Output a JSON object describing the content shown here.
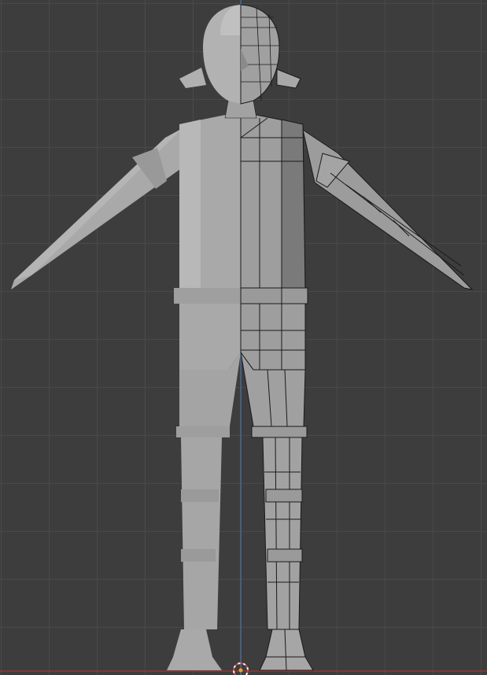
{
  "viewport": {
    "background_color": "#3d3d3d",
    "grid_color": "#4a4a4a",
    "axis_z_color": "#4a7ab8",
    "axis_x_color": "#9b3a3a"
  },
  "model": {
    "type": "low-poly humanoid character in T-pose",
    "body_color": "#a9a9a9",
    "highlight_color": "#bcbcbc",
    "shadow_color": "#7a7a7a",
    "wireframe_color": "#1a1a1a",
    "edit_mode_half": "right"
  },
  "cursor_3d": {
    "icon": "3d-cursor-icon",
    "fill_color": "#ffffff",
    "ring_color": "#d04040"
  }
}
